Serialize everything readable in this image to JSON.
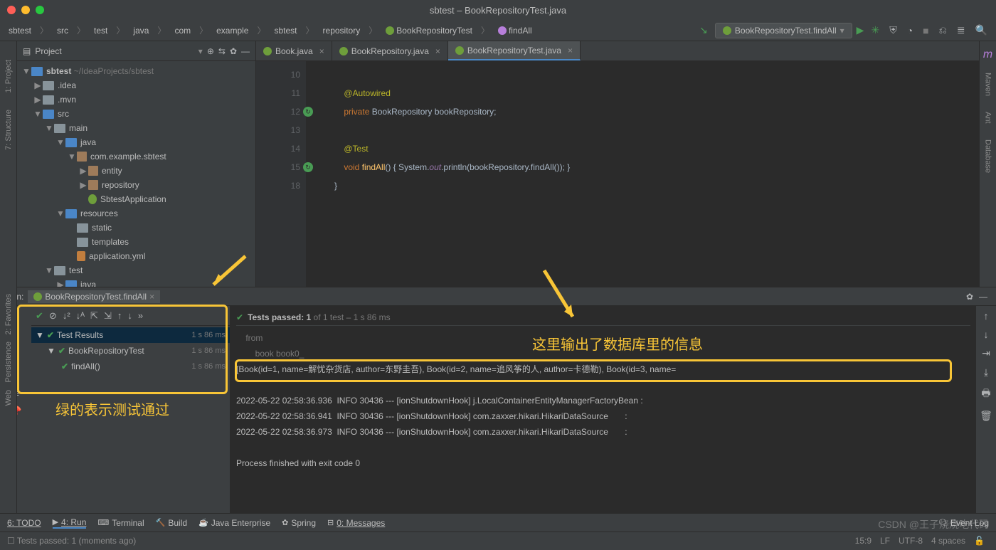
{
  "title": "sbtest – BookRepositoryTest.java",
  "breadcrumb": [
    "sbtest",
    "src",
    "test",
    "java",
    "com",
    "example",
    "sbtest",
    "repository",
    "BookRepositoryTest",
    "findAll"
  ],
  "runconfig": "BookRepositoryTest.findAll",
  "project": {
    "label": "Project",
    "root": "sbtest",
    "rootPath": "~/IdeaProjects/sbtest",
    "nodes": {
      "idea": ".idea",
      "mvn": ".mvn",
      "src": "src",
      "main": "main",
      "java": "java",
      "pkg": "com.example.sbtest",
      "entity": "entity",
      "repo": "repository",
      "app": "SbtestApplication",
      "res": "resources",
      "static": "static",
      "templates": "templates",
      "yml": "application.yml",
      "test": "test",
      "testjava": "java"
    }
  },
  "tabs": [
    {
      "label": "Book.java",
      "active": false
    },
    {
      "label": "BookRepository.java",
      "active": false
    },
    {
      "label": "BookRepositoryTest.java",
      "active": true
    }
  ],
  "code": {
    "lines": [
      "10",
      "11",
      "12",
      "13",
      "14",
      "15",
      "18"
    ],
    "l11_ann": "@Autowired",
    "l12_kw": "private",
    "l12_type": "BookRepository",
    "l12_var": "bookRepository",
    "l14_ann": "@Test",
    "l15_kw": "void",
    "l15_fn": "findAll",
    "l15_body": "() { System.",
    "l15_out": "out",
    "l15_mid": ".println(bookRepository.findAll()); }",
    "l18": "}"
  },
  "run": {
    "label": "Run:",
    "tab": "BookRepositoryTest.findAll",
    "status_pre": "Tests passed: 1",
    "status_post": " of 1 test – 1 s 86 ms",
    "tree": {
      "root": "Test Results",
      "rootTime": "1 s 86 ms",
      "cls": "BookRepositoryTest",
      "clsTime": "1 s 86 ms",
      "m": "findAll()",
      "mTime": "1 s 86 ms"
    },
    "console": {
      "l1": "    from",
      "l2": "        book book0_",
      "out": "[Book(id=1, name=解忧杂货店, author=东野圭吾), Book(id=2, name=追风筝的人, author=卡德勒), Book(id=3, name=",
      "log1": "2022-05-22 02:58:36.936  INFO 30436 --- [ionShutdownHook] j.LocalContainerEntityManagerFactoryBean :",
      "log2": "2022-05-22 02:58:36.941  INFO 30436 --- [ionShutdownHook] com.zaxxer.hikari.HikariDataSource       :",
      "log3": "2022-05-22 02:58:36.973  INFO 30436 --- [ionShutdownHook] com.zaxxer.hikari.HikariDataSource       :",
      "exit": "Process finished with exit code 0"
    }
  },
  "bottom": {
    "todo": "6: TODO",
    "run": "4: Run",
    "term": "Terminal",
    "build": "Build",
    "jee": "Java Enterprise",
    "spring": "Spring",
    "msgs": "0: Messages",
    "log": "Event Log"
  },
  "status": {
    "msg": "Tests passed: 1 (moments ago)",
    "pos": "15:9",
    "lf": "LF",
    "enc": "UTF-8",
    "spaces": "4 spaces"
  },
  "sidetools": {
    "proj": "1: Project",
    "struct": "7: Structure",
    "fav": "2: Favorites",
    "pers": "Persistence",
    "web": "Web",
    "maven": "Maven",
    "ant": "Ant",
    "db": "Database"
  },
  "annotations": {
    "a1": "绿的表示测试通过",
    "a2": "这里输出了数据库里的信息"
  },
  "watermark": "CSDN @王子烧烧吃代码"
}
